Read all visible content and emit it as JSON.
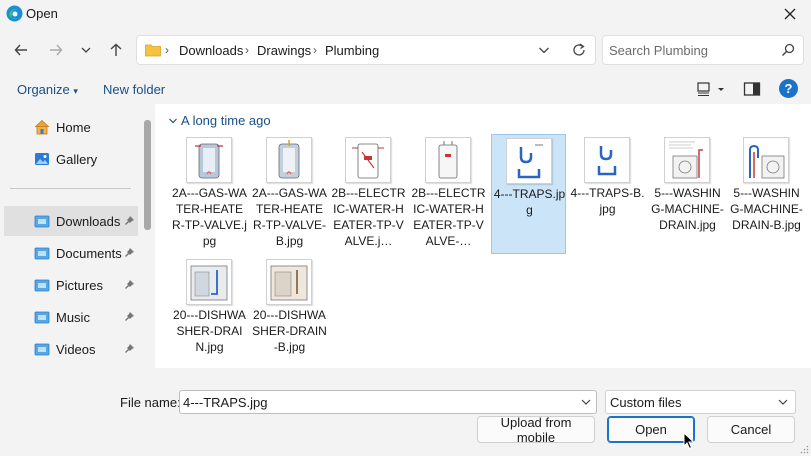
{
  "window": {
    "title": "Open"
  },
  "address": {
    "crumbs": [
      "Downloads",
      "Drawings",
      "Plumbing"
    ]
  },
  "search": {
    "placeholder": "Search Plumbing"
  },
  "toolbar": {
    "organize_label": "Organize",
    "new_folder_label": "New folder",
    "help_label": "?"
  },
  "sidebar": {
    "items": [
      {
        "label": "Home"
      },
      {
        "label": "Gallery"
      },
      {
        "label": "Downloads"
      },
      {
        "label": "Documents"
      },
      {
        "label": "Pictures"
      },
      {
        "label": "Music"
      },
      {
        "label": "Videos"
      }
    ]
  },
  "content": {
    "group_label": "A long time ago",
    "files": [
      {
        "name": "2A---GAS-WATER-HEATER-TP-VALVE.jpg"
      },
      {
        "name": "2A---GAS-WATER-HEATER-TP-VALVE-B.jpg"
      },
      {
        "name": "2B---ELECTRIC-WATER-HEATER-TP-VALVE.j…"
      },
      {
        "name": "2B---ELECTRIC-WATER-HEATER-TP-VALVE-…"
      },
      {
        "name": "4---TRAPS.jpg"
      },
      {
        "name": "4---TRAPS-B.jpg"
      },
      {
        "name": "5---WASHING-MACHINE-DRAIN.jpg"
      },
      {
        "name": "5---WASHING-MACHINE-DRAIN-B.jpg"
      },
      {
        "name": "20---DISHWASHER-DRAIN.jpg"
      },
      {
        "name": "20---DISHWASHER-DRAIN-B.jpg"
      }
    ]
  },
  "bottom": {
    "file_name_label": "File name:",
    "file_name_value": "4---TRAPS.jpg",
    "file_type_value": "Custom files",
    "upload_label": "Upload from mobile",
    "open_label": "Open",
    "cancel_label": "Cancel"
  },
  "colors": {
    "accent": "#1a73c9",
    "link": "#1a4f86",
    "selection": "#cce4f7"
  }
}
